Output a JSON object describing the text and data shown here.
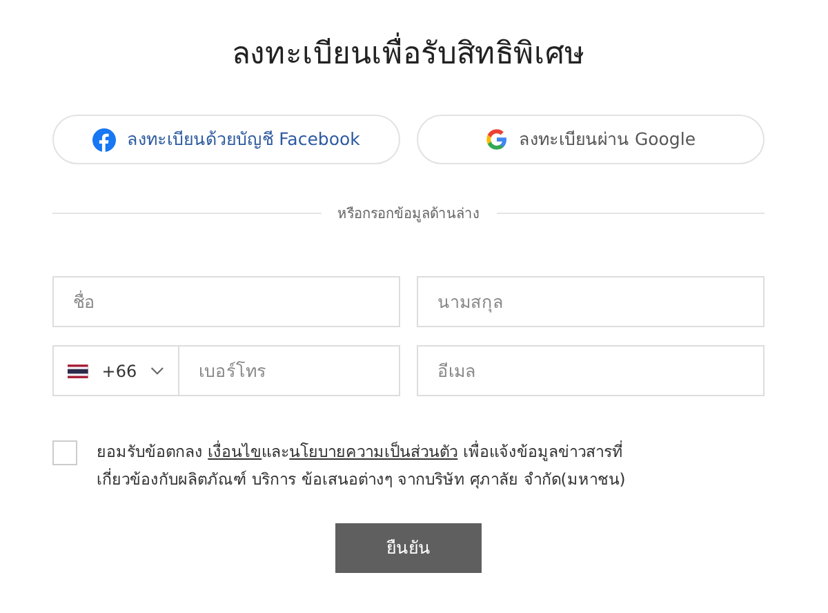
{
  "title": "ลงทะเบียนเพื่อรับสิทธิพิเศษ",
  "social_buttons": [
    {
      "kind": "facebook",
      "label": "ลงทะเบียนด้วยบัญชี Facebook"
    },
    {
      "kind": "google",
      "label": "ลงทะเบียนผ่าน Google"
    }
  ],
  "divider_text": "หรือกรอกข้อมูลด้านล่าง",
  "fields": {
    "first_name": {
      "placeholder": "ชื่อ"
    },
    "last_name": {
      "placeholder": "นามสกุล"
    },
    "country_code": "+66",
    "phone": {
      "placeholder": "เบอร์โทร"
    },
    "email": {
      "placeholder": "อีเมล"
    }
  },
  "consent": {
    "checked": false,
    "parts": [
      {
        "kind": "text",
        "text": "ยอมรับข้อตกลง "
      },
      {
        "kind": "link",
        "text": "เงื่อนไข"
      },
      {
        "kind": "text",
        "text": "และ"
      },
      {
        "kind": "link",
        "text": "นโยบายความเป็นส่วนตัว"
      },
      {
        "kind": "text",
        "text": " เพื่อแจ้งข้อมูลข่าวสารที่ เกี่ยวข้องกับผลิตภัณฑ์ บริการ ข้อเสนอต่างๆ จากบริษัท ศุภาลัย จำกัด(มหาชน)"
      }
    ]
  },
  "submit_button": "ยืนยัน"
}
